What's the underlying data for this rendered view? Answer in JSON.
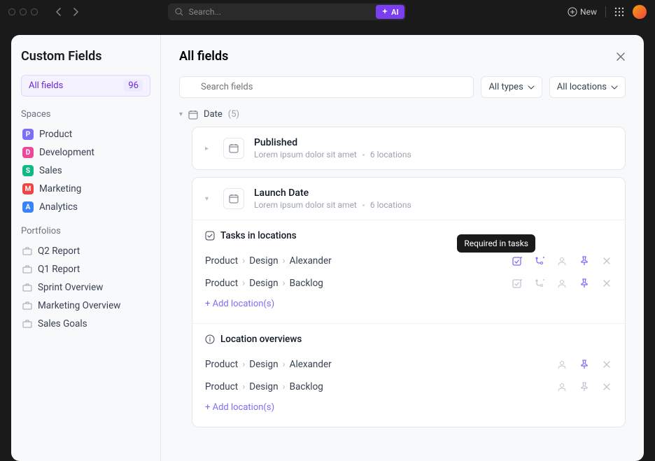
{
  "topbar": {
    "search_placeholder": "Search...",
    "ai_label": "AI",
    "new_label": "New"
  },
  "sidebar": {
    "title": "Custom Fields",
    "all_fields_label": "All fields",
    "all_fields_count": "96",
    "spaces_label": "Spaces",
    "spaces": [
      {
        "letter": "P",
        "name": "Product",
        "color": "bg-violet"
      },
      {
        "letter": "D",
        "name": "Development",
        "color": "bg-pink"
      },
      {
        "letter": "S",
        "name": "Sales",
        "color": "bg-green"
      },
      {
        "letter": "M",
        "name": "Marketing",
        "color": "bg-red"
      },
      {
        "letter": "A",
        "name": "Analytics",
        "color": "bg-blue"
      }
    ],
    "portfolios_label": "Portfolios",
    "portfolios": [
      {
        "name": "Q2 Report"
      },
      {
        "name": "Q1 Report"
      },
      {
        "name": "Sprint Overview"
      },
      {
        "name": "Marketing Overview"
      },
      {
        "name": "Sales Goals"
      }
    ]
  },
  "main": {
    "title": "All fields",
    "search_placeholder": "Search fields",
    "types_filter": "All types",
    "locations_filter": "All locations",
    "group": {
      "name": "Date",
      "count": "(5)"
    },
    "fields": [
      {
        "title": "Published",
        "desc": "Lorem ipsum dolor sit amet",
        "locations": "6 locations"
      },
      {
        "title": "Launch Date",
        "desc": "Lorem ipsum dolor sit amet",
        "locations": "6 locations"
      }
    ],
    "tasks_section": {
      "title": "Tasks in locations",
      "tooltip": "Required in tasks",
      "rows": [
        {
          "p1": "Product",
          "p2": "Design",
          "p3": "Alexander"
        },
        {
          "p1": "Product",
          "p2": "Design",
          "p3": "Backlog"
        }
      ],
      "add_label": "+ Add location(s)"
    },
    "overviews_section": {
      "title": "Location overviews",
      "rows": [
        {
          "p1": "Product",
          "p2": "Design",
          "p3": "Alexander"
        },
        {
          "p1": "Product",
          "p2": "Design",
          "p3": "Backlog"
        }
      ],
      "add_label": "+ Add location(s)"
    }
  }
}
